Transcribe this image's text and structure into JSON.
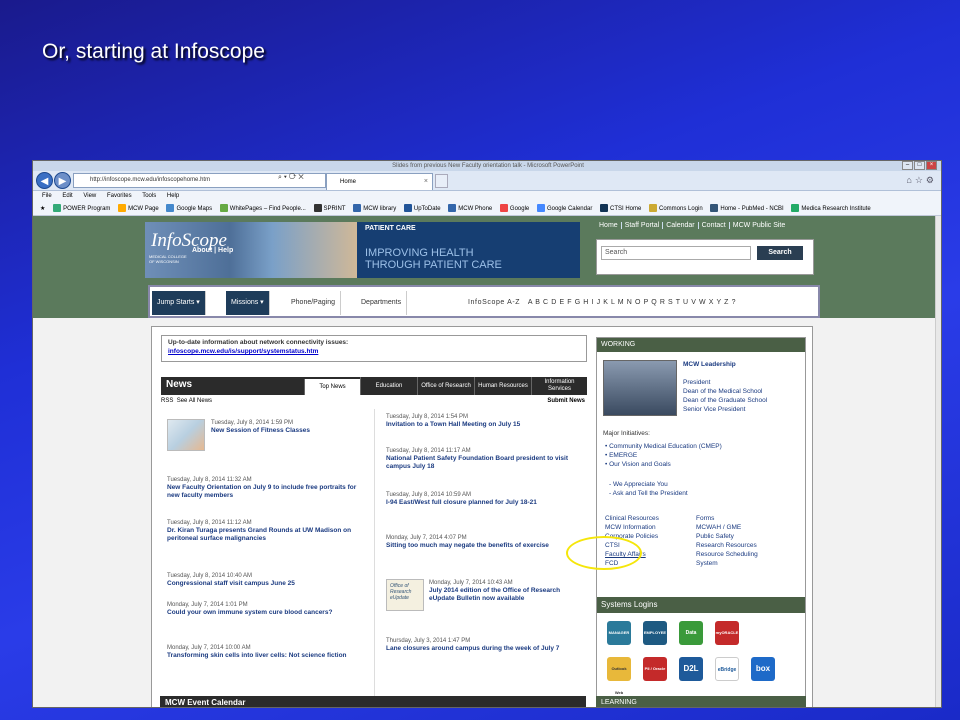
{
  "slide": {
    "title": "Or, starting at Infoscope"
  },
  "window": {
    "title": "Slides from previous New Faculty orientation talk - Microsoft PowerPoint"
  },
  "browser": {
    "url": "http://infoscope.mcw.edu/infoscopehome.htm",
    "tab_label": "Home",
    "menu": [
      "File",
      "Edit",
      "View",
      "Favorites",
      "Tools",
      "Help"
    ],
    "favorites": [
      "POWER Program",
      "MCW Page",
      "Google Maps",
      "WhitePages – Find People...",
      "SPRINT",
      "MCW library",
      "UpToDate",
      "MCW Phone",
      "Google",
      "Google Calendar",
      "CTSI Home",
      "Commons Login",
      "Home - PubMed - NCBI",
      "Medica Research Institute"
    ]
  },
  "site": {
    "logo": "InfoScope",
    "logo_links": "About | Help",
    "college": "MEDICAL COLLEGE OF WISCONSIN",
    "banner_label": "PATIENT CARE",
    "banner_line1": "IMPROVING HEALTH",
    "banner_line2": "THROUGH PATIENT CARE",
    "top_links": [
      "Home",
      "Staff Portal",
      "Calendar",
      "Contact",
      "MCW Public Site"
    ],
    "search_placeholder": "Search",
    "search_button": "Search",
    "nav_tabs": [
      "Jump Starts",
      "Missions",
      "Phone/Paging",
      "Departments"
    ],
    "az_label": "InfoScope A-Z",
    "alphabet": "A B C D E F G H I J K L M N O P Q R S T U V W X Y Z ?"
  },
  "alert": {
    "line1": "Up-to-date information about network connectivity issues:",
    "link": "infoscope.mcw.edu/is/support/systemstatus.htm"
  },
  "news": {
    "title": "News",
    "tabs": [
      "Top News",
      "Education",
      "Office of Research",
      "Human Resources",
      "Information Services"
    ],
    "rss": "RSS",
    "see_all": "See All News",
    "submit": "Submit News",
    "left": [
      {
        "date": "Tuesday, July 8, 2014 1:59 PM",
        "headline": "New Session of Fitness Classes"
      },
      {
        "date": "Tuesday, July 8, 2014 11:32 AM",
        "headline": "New Faculty Orientation on July 9 to include free portraits for new faculty members"
      },
      {
        "date": "Tuesday, July 8, 2014 11:12 AM",
        "headline": "Dr. Kiran Turaga presents Grand Rounds at UW Madison on peritoneal surface malignancies"
      },
      {
        "date": "Tuesday, July 8, 2014 10:40 AM",
        "headline": "Congressional staff visit campus June 25"
      },
      {
        "date": "Monday, July 7, 2014 1:01 PM",
        "headline": "Could your own immune system cure blood cancers?"
      },
      {
        "date": "Monday, July 7, 2014 10:00 AM",
        "headline": "Transforming skin cells into liver cells: Not science fiction"
      }
    ],
    "right": [
      {
        "date": "Tuesday, July 8, 2014 1:54 PM",
        "headline": "Invitation to a Town Hall Meeting on July 15"
      },
      {
        "date": "Tuesday, July 8, 2014 11:17 AM",
        "headline": "National Patient Safety Foundation Board president to visit campus July 18"
      },
      {
        "date": "Tuesday, July 8, 2014 10:59 AM",
        "headline": "I-94 East/West full closure planned for July 18-21"
      },
      {
        "date": "Monday, July 7, 2014 4:07 PM",
        "headline": "Sitting too much may negate the benefits of exercise"
      },
      {
        "date": "Monday, July 7, 2014 10:43 AM",
        "headline": "July 2014 edition of the Office of Research eUpdate Bulletin now available"
      },
      {
        "date": "Thursday, July 3, 2014 1:47 PM",
        "headline": "Lane closures around campus during the week of July 7"
      }
    ],
    "eupdate_badge": "Office of Research eUpdate"
  },
  "working": {
    "title": "WORKING",
    "leadership_title": "MCW Leadership",
    "leadership": [
      "President",
      "Dean of the Medical School",
      "Dean of the Graduate School",
      "Senior Vice President"
    ],
    "initiatives_label": "Major Initiatives:",
    "initiatives": [
      "Community Medical Education (CMEP)",
      "EMERGE",
      "Our Vision and Goals"
    ],
    "extra": [
      "- We Appreciate You",
      "- Ask and Tell the President"
    ],
    "col1": [
      "Clinical Resources",
      "MCW Information",
      "Corporate Policies",
      "CTSI",
      "Faculty Affairs",
      "FCD"
    ],
    "col2": [
      "Forms",
      "MCWAH / GME",
      "Public Safety",
      "Research Resources",
      "Resource Scheduling",
      "System"
    ]
  },
  "systems": {
    "title": "Systems Logins",
    "row1": [
      "MANAGER",
      "EMPLOYEE",
      "Data",
      "myORACLE"
    ],
    "row2": [
      "Outlook Web",
      "PII / Oracle",
      "D2L",
      "eBridge",
      "box"
    ]
  },
  "bottom": {
    "calendar": "MCW Event Calendar",
    "learning": "LEARNING"
  },
  "colors": {
    "slide_bg": "#1f2fd6",
    "site_green": "#5b7a5c",
    "nav_dark": "#1e3c5a",
    "highlight": "#f5e60a"
  }
}
